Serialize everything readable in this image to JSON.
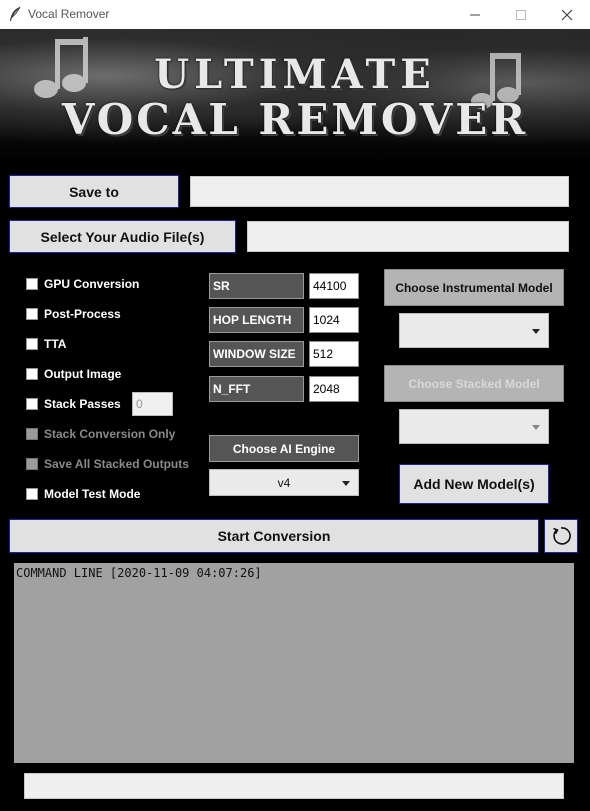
{
  "window": {
    "title": "Vocal Remover",
    "controls": [
      "minimize-icon",
      "maximize-icon",
      "close-icon"
    ]
  },
  "banner": {
    "line1": "ULTIMATE",
    "line2": "VOCAL REMOVER"
  },
  "io": {
    "save_to_label": "Save to",
    "save_to_value": "",
    "select_files_label": "Select Your Audio File(s)",
    "select_files_value": ""
  },
  "options": {
    "gpu_conversion": "GPU Conversion",
    "post_process": "Post-Process",
    "tta": "TTA",
    "output_image": "Output Image",
    "stack_passes": "Stack Passes",
    "stack_passes_value": "0",
    "stack_conversion_only": "Stack Conversion Only",
    "save_all_stacked_outputs": "Save All Stacked Outputs",
    "model_test_mode": "Model Test Mode"
  },
  "params": [
    {
      "label": "SR",
      "value": "44100"
    },
    {
      "label": "HOP LENGTH",
      "value": "1024"
    },
    {
      "label": "WINDOW SIZE",
      "value": "512"
    },
    {
      "label": "N_FFT",
      "value": "2048"
    }
  ],
  "engine": {
    "button": "Choose AI Engine",
    "selected": "v4"
  },
  "models": {
    "instrumental_button": "Choose Instrumental Model",
    "instrumental_selected": "",
    "stacked_button": "Choose Stacked Model",
    "stacked_selected": "",
    "add_new": "Add New Model(s)"
  },
  "actions": {
    "start": "Start Conversion",
    "reset_icon": "refresh-icon"
  },
  "log": {
    "text": "COMMAND LINE [2020-11-09 04:07:26]"
  },
  "progress": {
    "value": 0
  },
  "colors": {
    "background": "#000000",
    "accent_border": "#2020a8",
    "log_bg": "#a1a1a1",
    "param_label_bg": "#555555"
  }
}
